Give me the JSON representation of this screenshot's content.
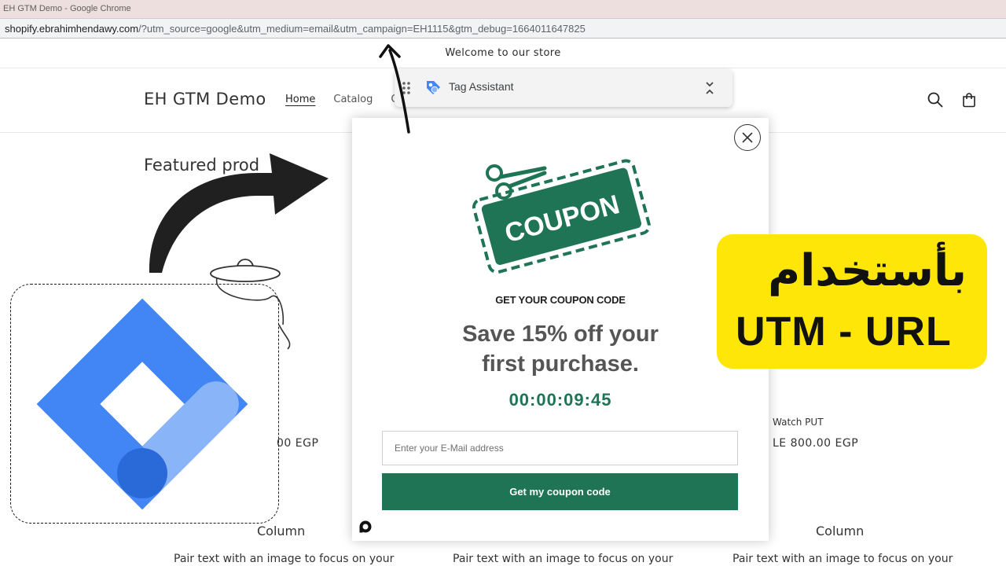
{
  "window": {
    "title": "EH GTM Demo - Google Chrome"
  },
  "address_bar": {
    "host": "shopify.ebrahimhendawy.com",
    "path_query": "/?utm_source=google&utm_medium=email&utm_campaign=EH1115&gtm_debug=1664011647825"
  },
  "store": {
    "announcement": "Welcome to our store",
    "brand": "EH GTM Demo",
    "nav": [
      "Home",
      "Catalog",
      "C"
    ],
    "featured_title": "Featured prod",
    "product_left_price": "00 EGP",
    "product_right_name": "Watch PUT",
    "product_right_price": "LE 800.00 EGP",
    "column_title_1": "Column",
    "column_title_3": "Column",
    "column_text_1": "Pair text with an image to focus on your",
    "column_text_2": "Pair text with an image to focus on your",
    "column_text_3": "Pair text with an image to focus on your",
    "icons": [
      "search-icon",
      "cart-icon"
    ]
  },
  "tag_assistant": {
    "label": "Tag Assistant"
  },
  "popup": {
    "coupon_badge": "COUPON",
    "pretitle": "GET YOUR COUPON CODE",
    "headline_line1": "Save 15% off your",
    "headline_line2": "first purchase.",
    "timer": "00:00:09:45",
    "email_placeholder": "Enter your E-Mail address",
    "cta": "Get my coupon code",
    "brand_color": "#1f7456"
  },
  "overlay": {
    "arabic_text": "بأستخدام",
    "english_text": "UTM - URL",
    "highlight_color": "#fee608"
  }
}
